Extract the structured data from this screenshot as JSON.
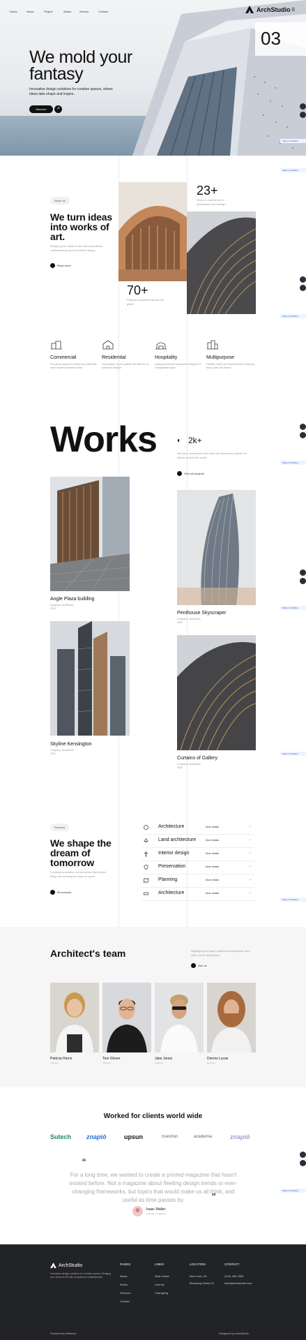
{
  "nav": {
    "links": [
      "Home",
      "About",
      "Project",
      "Works",
      "Service",
      "Contact"
    ],
    "brand": "ArchStudio"
  },
  "hero": {
    "title_line1": "We mold your",
    "title_line2": "fantasy",
    "subtitle": "Innovative design solutions for creative spaces, where ideas take shape and inspire.",
    "cta": "Discover",
    "slide_number": "03"
  },
  "side_widget": {
    "label": "Made in Webflow"
  },
  "about": {
    "tag": "About us",
    "heading": "We turn ideas into works of art.",
    "text": "Bringing your vision to life with exceptional craftsmanship and innovative design.",
    "link": "Read more",
    "stat1_value": "23+",
    "stat1_label": "Years of experience in architecture and design",
    "stat2_value": "70+",
    "stat2_label": "Projects completed across the globe"
  },
  "services": [
    {
      "title": "Commercial",
      "icon": "building-icon",
      "text": "Functional spaces for offices and retail that meet modern business needs."
    },
    {
      "title": "Residential",
      "icon": "house-icon",
      "text": "Comfortable homes crafted with attention to detail and lifestyle."
    },
    {
      "title": "Hospitality",
      "icon": "hotel-icon",
      "text": "Inviting hotels and restaurants designed for unforgettable stays."
    },
    {
      "title": "Multipurpose",
      "icon": "city-icon",
      "text": "Flexible mixed-use developments combining living, work and leisure."
    }
  ],
  "works": {
    "title": "Works",
    "stat_value": "2k+",
    "stat_text": "We have completed more than two thousand projects for clients around the world.",
    "link": "View all projects",
    "items": [
      {
        "title": "Angle Plaza building",
        "meta1": "Company: ArchStudio",
        "meta2": "2023"
      },
      {
        "title": "Penthouse Skyscraper",
        "meta1": "Company: ArchStudio",
        "meta2": "2022"
      },
      {
        "title": "Skyline Kensington",
        "meta1": "Company: ArchStudio",
        "meta2": "2021"
      },
      {
        "title": "Curtains of Gallery",
        "meta1": "Company: ArchStudio",
        "meta2": "2020"
      }
    ]
  },
  "service_section": {
    "tag": "Services",
    "heading": "We shape the dream of tomorrow",
    "text": "Creating innovative environments that inspire living and working for years to come.",
    "link": "All services",
    "rows": [
      {
        "name": "Architecture",
        "more": "More details",
        "icon": "compass-icon"
      },
      {
        "name": "Land architecture",
        "more": "More details",
        "icon": "tree-icon"
      },
      {
        "name": "Interior design",
        "more": "More details",
        "icon": "lamp-icon"
      },
      {
        "name": "Preservation",
        "more": "More details",
        "icon": "shield-icon"
      },
      {
        "name": "Planning",
        "more": "More details",
        "icon": "map-icon"
      },
      {
        "name": "Architecture",
        "more": "More details",
        "icon": "ruler-icon"
      }
    ]
  },
  "team": {
    "heading": "Architect's team",
    "text": "Highlight your team's skills and experience here with a short description.",
    "link": "Join us",
    "members": [
      {
        "name": "Patricia Harris",
        "role": "Architect"
      },
      {
        "name": "Tom Glover",
        "role": "Architect"
      },
      {
        "name": "Jake Jones",
        "role": "Designer"
      },
      {
        "name": "Dennis Lucas",
        "role": "Engineer"
      }
    ]
  },
  "clients": {
    "heading": "Worked for clients world wide",
    "logos": [
      "Sutech",
      "znapiō",
      "upsun",
      "trueshon",
      "academia",
      "znapiō"
    ]
  },
  "testimonial": {
    "quote": "For a long time, we wanted to create a printed magazine that hasn't existed before. Not a magazine about fleeting design trends or ever-changing frameworks, but topics that would make us all think, and useful as time passes by.",
    "author": "Isaac Waller",
    "role": "Founder of magazine"
  },
  "footer": {
    "brand": "ArchStudio",
    "about": "Innovative design solutions for creative spaces. Bringing your vision to life with exceptional craftsmanship.",
    "columns": [
      {
        "head": "PAGES",
        "items": [
          "About",
          "Works",
          "Services",
          "Contact"
        ]
      },
      {
        "head": "LINKS",
        "items": [
          "Style Guide",
          "License",
          "Changelog"
        ]
      },
      {
        "head": "LOCATION",
        "items": [
          "New York, US",
          "Broadway Street 12"
        ]
      },
      {
        "head": "CONTACT",
        "items": [
          "(123) 456-7890",
          "hello@archstudio.com"
        ]
      }
    ],
    "copyright": "Powered by Webflow",
    "credit": "Designed by ArchStudio"
  },
  "colors": {
    "dark": "#222326",
    "accent": "#111111",
    "light_bg": "#f6f6f6"
  }
}
